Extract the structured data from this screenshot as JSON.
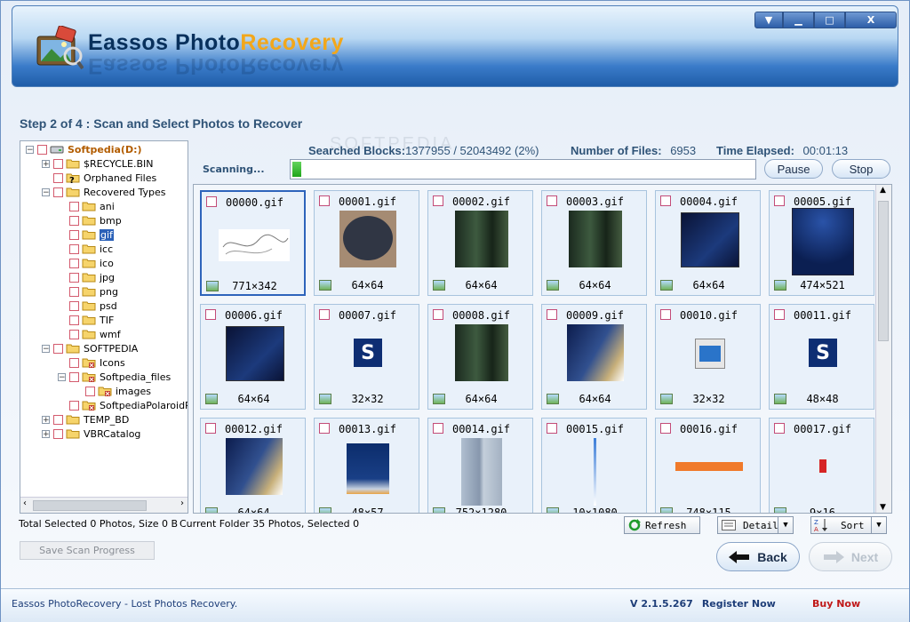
{
  "window": {
    "brand_part1": "Eassos Photo",
    "brand_part2": "Recovery",
    "controls": [
      "▼",
      "▁",
      "□",
      "X"
    ]
  },
  "step_title": "Step 2 of 4 : Scan and Select Photos to Recover",
  "tree": {
    "items": [
      {
        "label": "Softpedia(D:)",
        "depth": 0,
        "expander": "−",
        "icon": "drive-icon",
        "bold": true
      },
      {
        "label": "$RECYCLE.BIN",
        "depth": 1,
        "expander": "+",
        "icon": "folder-icon"
      },
      {
        "label": "Orphaned Files",
        "depth": 1,
        "expander": "",
        "icon": "folder-question-icon"
      },
      {
        "label": "Recovered Types",
        "depth": 1,
        "expander": "−",
        "icon": "folder-icon"
      },
      {
        "label": "ani",
        "depth": 2,
        "expander": "",
        "icon": "folder-icon"
      },
      {
        "label": "bmp",
        "depth": 2,
        "expander": "",
        "icon": "folder-icon"
      },
      {
        "label": "gif",
        "depth": 2,
        "expander": "",
        "icon": "folder-icon",
        "selected": true
      },
      {
        "label": "icc",
        "depth": 2,
        "expander": "",
        "icon": "folder-icon"
      },
      {
        "label": "ico",
        "depth": 2,
        "expander": "",
        "icon": "folder-icon"
      },
      {
        "label": "jpg",
        "depth": 2,
        "expander": "",
        "icon": "folder-icon"
      },
      {
        "label": "png",
        "depth": 2,
        "expander": "",
        "icon": "folder-icon"
      },
      {
        "label": "psd",
        "depth": 2,
        "expander": "",
        "icon": "folder-icon"
      },
      {
        "label": "TIF",
        "depth": 2,
        "expander": "",
        "icon": "folder-icon"
      },
      {
        "label": "wmf",
        "depth": 2,
        "expander": "",
        "icon": "folder-icon"
      },
      {
        "label": "SOFTPEDIA",
        "depth": 1,
        "expander": "−",
        "icon": "folder-icon"
      },
      {
        "label": "Icons",
        "depth": 2,
        "expander": "",
        "icon": "folder-deleted-icon"
      },
      {
        "label": "Softpedia_files",
        "depth": 2,
        "expander": "−",
        "icon": "folder-deleted-icon"
      },
      {
        "label": "images",
        "depth": 3,
        "expander": "",
        "icon": "folder-deleted-icon"
      },
      {
        "label": "SoftpediaPolaroidPu",
        "depth": 2,
        "expander": "",
        "icon": "folder-deleted-icon"
      },
      {
        "label": "TEMP_BD",
        "depth": 1,
        "expander": "+",
        "icon": "folder-icon"
      },
      {
        "label": "VBRCatalog",
        "depth": 1,
        "expander": "+",
        "icon": "folder-icon"
      }
    ]
  },
  "scan": {
    "searched_label": "Searched Blocks:",
    "searched_value": "1377955 / 52043492 (2%)",
    "files_label": "Number of Files:",
    "files_value": "6953",
    "elapsed_label": "Time Elapsed:",
    "elapsed_value": "00:01:13",
    "status": "Scanning...",
    "progress_percent": 2,
    "pause_label": "Pause",
    "stop_label": "Stop"
  },
  "tiles": [
    {
      "name": "00000.gif",
      "size": "771×342",
      "thumb": "sketch",
      "selected": true
    },
    {
      "name": "00001.gif",
      "size": "64×64",
      "thumb": "oval"
    },
    {
      "name": "00002.gif",
      "size": "64×64",
      "thumb": "forest"
    },
    {
      "name": "00003.gif",
      "size": "64×64",
      "thumb": "forest"
    },
    {
      "name": "00004.gif",
      "size": "64×64",
      "thumb": "boxes"
    },
    {
      "name": "00005.gif",
      "size": "474×521",
      "thumb": "cover"
    },
    {
      "name": "00006.gif",
      "size": "64×64",
      "thumb": "boxes"
    },
    {
      "name": "00007.gif",
      "size": "32×32",
      "thumb": "s-icon"
    },
    {
      "name": "00008.gif",
      "size": "64×64",
      "thumb": "forest"
    },
    {
      "name": "00009.gif",
      "size": "64×64",
      "thumb": "collage"
    },
    {
      "name": "00010.gif",
      "size": "32×32",
      "thumb": "monitor"
    },
    {
      "name": "00011.gif",
      "size": "48×48",
      "thumb": "s-icon"
    },
    {
      "name": "00012.gif",
      "size": "64×64",
      "thumb": "collage"
    },
    {
      "name": "00013.gif",
      "size": "48×57",
      "thumb": "gradient"
    },
    {
      "name": "00014.gif",
      "size": "752×1280",
      "thumb": "bars"
    },
    {
      "name": "00015.gif",
      "size": "10×1080",
      "thumb": "line"
    },
    {
      "name": "00016.gif",
      "size": "748×115",
      "thumb": "orange"
    },
    {
      "name": "00017.gif",
      "size": "9×16",
      "thumb": "red"
    }
  ],
  "status": {
    "total_selected": "Total Selected 0 Photos, Size 0 B",
    "current_folder": "Current Folder 35 Photos, Selected 0"
  },
  "toolbar": {
    "refresh_label": "Refresh",
    "view_label": "Detail",
    "sort_label": "Sort"
  },
  "save_progress_label": "Save Scan Progress",
  "nav": {
    "back_label": "Back",
    "next_label": "Next"
  },
  "footer": {
    "left": "Eassos PhotoRecovery - Lost Photos Recovery.",
    "version": "V 2.1.5.267",
    "register": "Register Now",
    "buy": "Buy Now"
  },
  "watermark": "SOFTPEDIA",
  "colors": {
    "accent": "#f2a71b",
    "header_dark": "#1f5da8",
    "progress": "#1ea51a",
    "buy": "#c01818"
  }
}
